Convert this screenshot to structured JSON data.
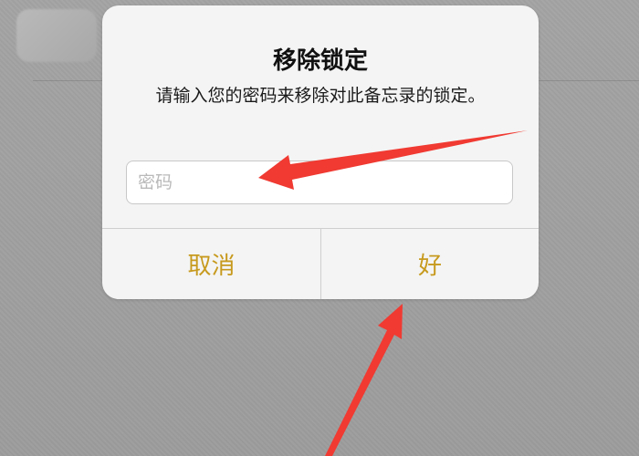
{
  "dialog": {
    "title": "移除锁定",
    "message": "请输入您的密码来移除对此备忘录的锁定。",
    "password_placeholder": "密码",
    "password_value": "",
    "cancel_label": "取消",
    "ok_label": "好"
  },
  "colors": {
    "action_text": "#c79a1e",
    "annotation_arrow": "#f03a32",
    "dialog_bg": "#f4f4f4",
    "backdrop": "#9e9e9e"
  }
}
